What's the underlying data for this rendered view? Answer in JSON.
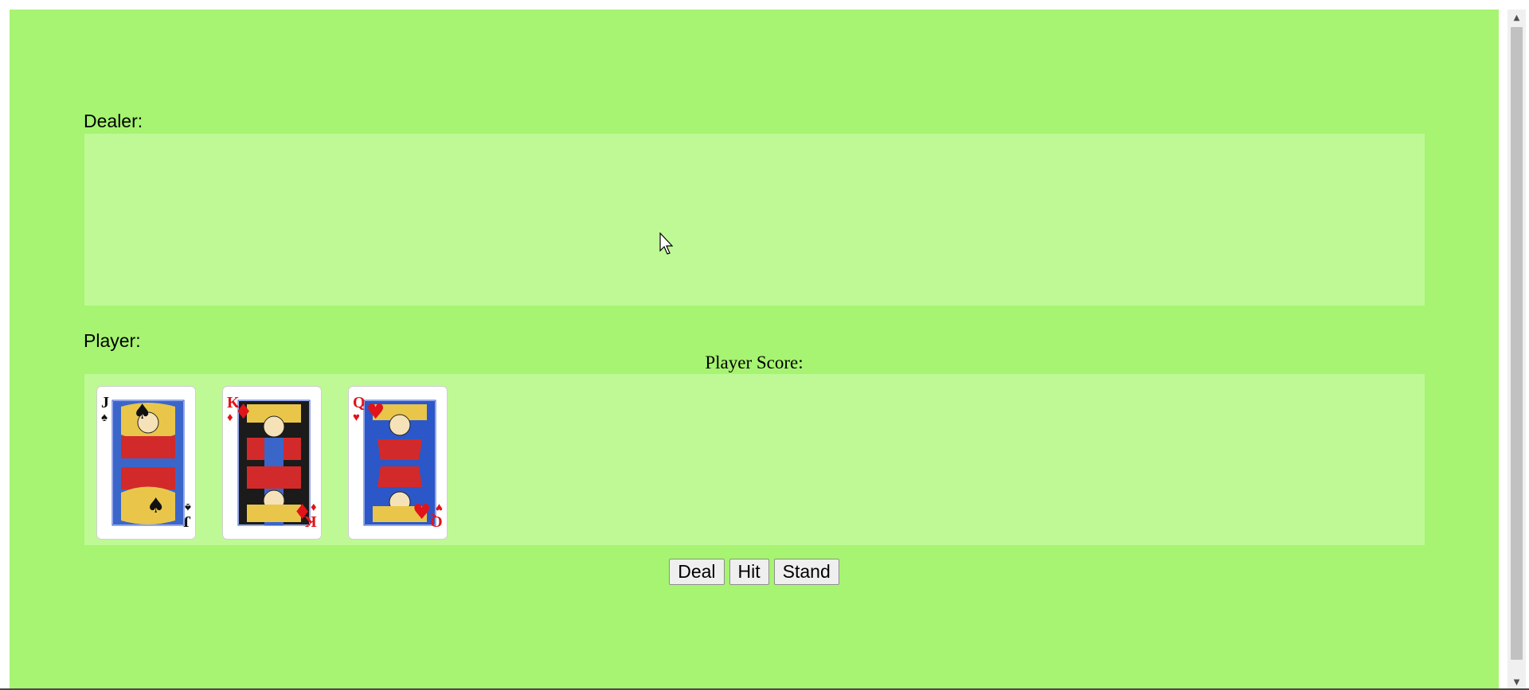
{
  "dealer": {
    "label": "Dealer:",
    "cards": []
  },
  "player": {
    "label": "Player:",
    "score_label": "Player Score:",
    "cards": [
      {
        "rank": "J",
        "suit": "spades",
        "suit_symbol": "♠",
        "color": "#111111",
        "face": "jack-of-spades"
      },
      {
        "rank": "K",
        "suit": "diamonds",
        "suit_symbol": "♦",
        "color": "#e0141a",
        "face": "king-of-diamonds"
      },
      {
        "rank": "Q",
        "suit": "hearts",
        "suit_symbol": "♥",
        "color": "#e0141a",
        "face": "queen-of-hearts"
      }
    ]
  },
  "buttons": {
    "deal": "Deal",
    "hit": "Hit",
    "stand": "Stand"
  },
  "colors": {
    "table": "#a6f471",
    "area": "#bff996"
  },
  "scrollbar": {
    "up_icon": "▲",
    "down_icon": "▼"
  }
}
